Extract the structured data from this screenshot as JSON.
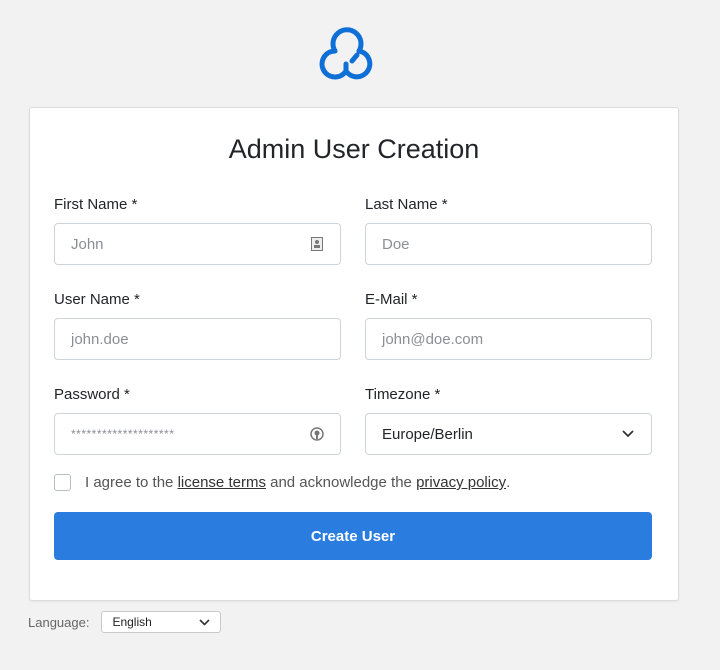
{
  "brand": {
    "logo_icon": "cloud-icon",
    "color": "#0e6fd6"
  },
  "form": {
    "title": "Admin User Creation",
    "fields": {
      "first_name": {
        "label": "First Name *",
        "placeholder": "John",
        "icon": "contact-card-icon"
      },
      "last_name": {
        "label": "Last Name *",
        "placeholder": "Doe"
      },
      "user_name": {
        "label": "User Name *",
        "placeholder": "john.doe"
      },
      "email": {
        "label": "E-Mail *",
        "placeholder": "john@doe.com"
      },
      "password": {
        "label": "Password *",
        "value": "********************",
        "icon": "password-manager-icon"
      },
      "timezone": {
        "label": "Timezone *",
        "value": "Europe/Berlin"
      }
    },
    "agree": {
      "prefix": "I agree to the ",
      "license_link": "license terms",
      "middle": " and acknowledge the ",
      "privacy_link": "privacy policy",
      "suffix": "."
    },
    "submit_label": "Create User",
    "accent_color": "#2a7ddf"
  },
  "footer": {
    "language_label": "Language:",
    "language_value": "English"
  }
}
